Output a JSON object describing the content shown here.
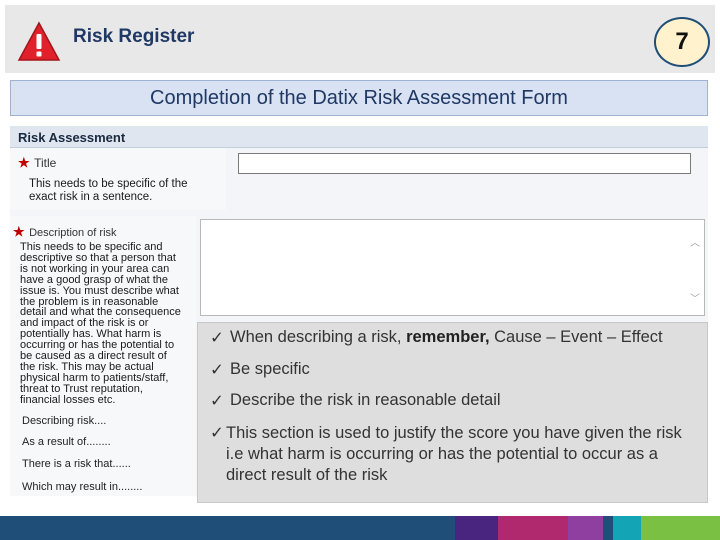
{
  "header": {
    "title": "Risk Register",
    "page_number": "7"
  },
  "subtitle": "Completion of the Datix Risk Assessment Form",
  "form": {
    "section_title": "Risk Assessment",
    "title_field": {
      "label": "Title",
      "help": [
        "This needs to be specific of the",
        "exact risk in a sentence."
      ],
      "value": ""
    },
    "description_field": {
      "label": "Description of risk",
      "help": [
        "This needs to be specific and",
        "descriptive so that a person that",
        "is not working in your area can",
        "have a good grasp of what the",
        "issue is. You must describe what",
        "the problem is in reasonable",
        "detail and what the consequence",
        "and impact of the risk is or",
        "potentially has. What harm is",
        "occurring or has the potential to",
        "be caused as a direct result of",
        "the risk. This may be actual",
        "physical harm to patients/staff,",
        "threat to Trust reputation,",
        "financial losses etc."
      ],
      "value": ""
    },
    "prompts": [
      "Describing risk....",
      "As a result of........",
      "There is a risk that......",
      "Which may result in........"
    ]
  },
  "callout": {
    "bullet1_prefix": "When describing a risk, ",
    "bullet1_bold": "remember,",
    "bullet1_suffix": " Cause – Event – Effect",
    "bullet2": "Be specific",
    "bullet3": "Describe the risk in reasonable detail",
    "bullet4": "This section is used to justify the score you have given the risk i.e what harm is occurring or has the potential to occur as a direct result of the risk",
    "check_glyph": "ü"
  },
  "colors": {
    "title_text": "#1f3864",
    "badge_fill": "#fff2cc",
    "required_star": "#c00000",
    "footer": [
      "#1f4e79",
      "#4a2580",
      "#b0286e",
      "#8e3fa0",
      "#1f4e79",
      "#13a5b5",
      "#7ac143"
    ]
  }
}
